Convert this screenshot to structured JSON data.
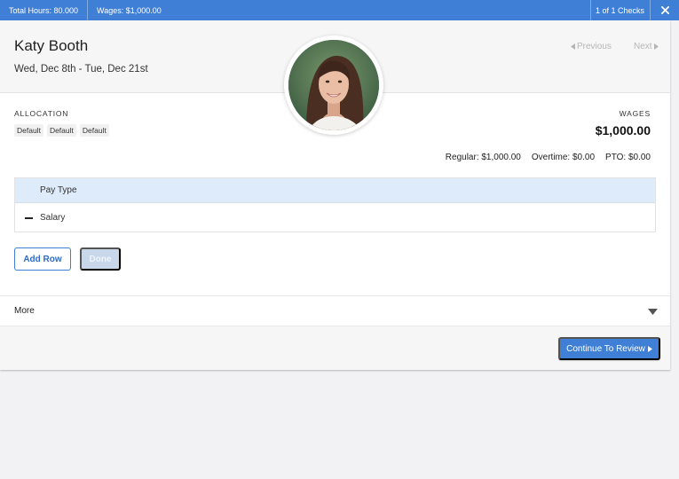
{
  "topbar": {
    "total_hours": "Total Hours: 80.000",
    "wages": "Wages: $1,000.00",
    "check_count": "1 of 1 Checks",
    "close_icon": "close-icon"
  },
  "header": {
    "employee_name": "Katy Booth",
    "date_range": "Wed, Dec 8th - Tue, Dec 21st",
    "previous_label": "Previous",
    "next_label": "Next"
  },
  "allocation": {
    "label": "ALLOCATION",
    "chips": [
      "Default",
      "Default",
      "Default"
    ]
  },
  "wages": {
    "label": "WAGES",
    "amount": "$1,000.00",
    "regular": "Regular: $1,000.00",
    "overtime": "Overtime: $0.00",
    "pto": "PTO: $0.00"
  },
  "pay_table": {
    "header": "Pay Type",
    "rows": [
      {
        "value": "Salary"
      }
    ]
  },
  "actions": {
    "add_row_label": "Add Row",
    "done_label": "Done"
  },
  "more": {
    "label": "More"
  },
  "footer": {
    "continue_label": "Continue To Review"
  },
  "colors": {
    "accent": "#3f7fd6",
    "table_header": "#deebfb",
    "disabled_button": "#c9d7ea"
  }
}
